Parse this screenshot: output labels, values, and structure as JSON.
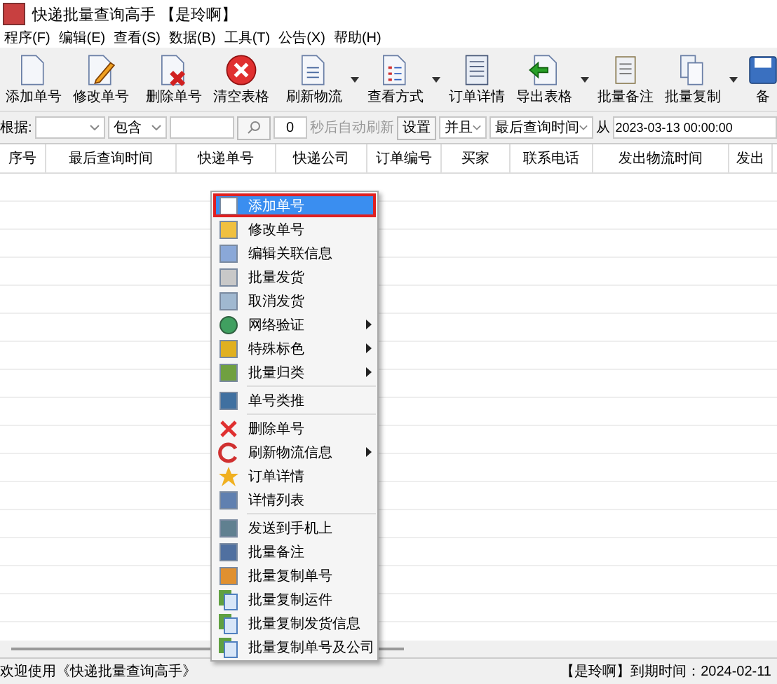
{
  "window": {
    "title": "快递批量查询高手 【是玲啊】"
  },
  "menu": [
    "程序(F)",
    "编辑(E)",
    "查看(S)",
    "数据(B)",
    "工具(T)",
    "公告(X)",
    "帮助(H)"
  ],
  "toolbar": [
    {
      "label": "添加单号",
      "dropdown": false
    },
    {
      "label": "修改单号",
      "dropdown": false
    },
    {
      "label": "删除单号",
      "dropdown": false
    },
    {
      "label": "清空表格",
      "dropdown": false
    },
    {
      "label": "刷新物流",
      "dropdown": true
    },
    {
      "label": "查看方式",
      "dropdown": true
    },
    {
      "label": "订单详情",
      "dropdown": false
    },
    {
      "label": "导出表格",
      "dropdown": true
    },
    {
      "label": "批量备注",
      "dropdown": false
    },
    {
      "label": "批量复制",
      "dropdown": true
    },
    {
      "label": "备",
      "dropdown": false
    }
  ],
  "filter": {
    "label": "根据:",
    "match": "包含",
    "interval": "0",
    "interval_label": "秒后自动刷新",
    "settings_button": "设置",
    "logic": "并且",
    "field": "最后查询时间",
    "from_label": "从",
    "from_value": "2023-03-13 00:00:00"
  },
  "table": {
    "columns": [
      "序号",
      "最后查询时间",
      "快递单号",
      "快递公司",
      "订单编号",
      "买家",
      "联系电话",
      "发出物流时间",
      "发出"
    ]
  },
  "context_menu": [
    {
      "kind": "item",
      "label": "添加单号",
      "submenu": false,
      "selected": true
    },
    {
      "kind": "item",
      "label": "修改单号",
      "submenu": false,
      "selected": false
    },
    {
      "kind": "item",
      "label": "编辑关联信息",
      "submenu": false,
      "selected": false
    },
    {
      "kind": "item",
      "label": "批量发货",
      "submenu": false,
      "selected": false
    },
    {
      "kind": "item",
      "label": "取消发货",
      "submenu": false,
      "selected": false
    },
    {
      "kind": "item",
      "label": "网络验证",
      "submenu": true,
      "selected": false
    },
    {
      "kind": "item",
      "label": "特殊标色",
      "submenu": true,
      "selected": false
    },
    {
      "kind": "item",
      "label": "批量归类",
      "submenu": true,
      "selected": false
    },
    {
      "kind": "separator"
    },
    {
      "kind": "item",
      "label": "单号类推",
      "submenu": false,
      "selected": false
    },
    {
      "kind": "separator"
    },
    {
      "kind": "item",
      "label": "删除单号",
      "submenu": false,
      "selected": false
    },
    {
      "kind": "item",
      "label": "刷新物流信息",
      "submenu": true,
      "selected": false
    },
    {
      "kind": "item",
      "label": "订单详情",
      "submenu": false,
      "selected": false
    },
    {
      "kind": "item",
      "label": "详情列表",
      "submenu": false,
      "selected": false
    },
    {
      "kind": "separator"
    },
    {
      "kind": "item",
      "label": "发送到手机上",
      "submenu": false,
      "selected": false
    },
    {
      "kind": "item",
      "label": "批量备注",
      "submenu": false,
      "selected": false
    },
    {
      "kind": "item",
      "label": "批量复制单号",
      "submenu": false,
      "selected": false
    },
    {
      "kind": "item",
      "label": "批量复制运件",
      "submenu": false,
      "selected": false
    },
    {
      "kind": "item",
      "label": "批量复制发货信息",
      "submenu": false,
      "selected": false
    },
    {
      "kind": "item",
      "label": "批量复制单号及公司",
      "submenu": false,
      "selected": false
    }
  ],
  "status_bar": {
    "left": "欢迎使用《快递批量查询高手》",
    "right": "【是玲啊】到期时间：2024-02-11"
  }
}
